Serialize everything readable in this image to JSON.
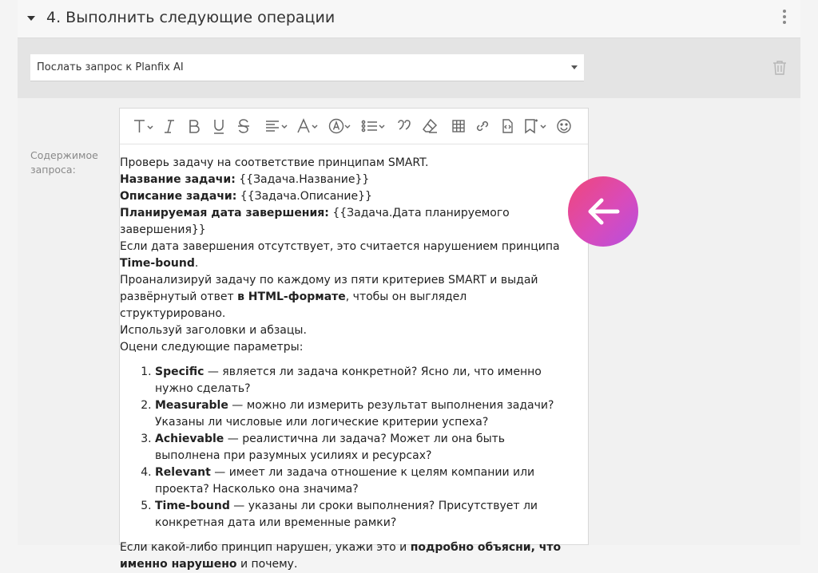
{
  "header": {
    "title": "4. Выполнить следующие операции"
  },
  "action": {
    "selected": "Послать запрос к Planfix AI"
  },
  "field": {
    "label_line1": "Содержимое",
    "label_line2": "запроса:"
  },
  "toolbar": {
    "icons": [
      "text-style-icon",
      "italic-icon",
      "bold-icon",
      "underline-icon",
      "strikethrough-icon",
      "align-icon",
      "font-color-icon",
      "highlight-icon",
      "list-icon",
      "quote-icon",
      "clear-format-icon",
      "table-icon",
      "link-icon",
      "code-icon",
      "bookmark-icon",
      "emoji-icon"
    ]
  },
  "content": {
    "line1": "Проверь задачу на соответствие принципам SMART.",
    "name_label": "Название задачи:",
    "name_value": " {{Задача.Название}}",
    "desc_label": "Описание задачи:",
    "desc_value": " {{Задача.Описание}}",
    "date_label": "Планируемая дата завершения:",
    "date_value": " {{Задача.Дата планируемого завершения}}",
    "missing_text": "Если дата завершения отсутствует, это считается нарушением принципа ",
    "missing_bold": "Time-bound",
    "missing_end": ".",
    "analyze_text": "Проанализируй задачу по каждому из пяти критериев SMART и выдай развёрнутый ответ ",
    "analyze_bold": "в HTML-формате",
    "analyze_end": ", чтобы он выглядел структурировано.",
    "use_text": "Используй заголовки и абзацы.",
    "eval_text": "Оцени следующие параметры:",
    "criteria": [
      {
        "name": "Specific",
        "text": " — является ли задача конкретной? Ясно ли, что именно нужно сделать?"
      },
      {
        "name": "Measurable",
        "text": " — можно ли измерить результат выполнения задачи? Указаны ли числовые или логические критерии успеха?"
      },
      {
        "name": "Achievable",
        "text": " — реалистична ли задача? Может ли она быть выполнена при разумных усилиях и ресурсах?"
      },
      {
        "name": "Relevant",
        "text": " — имеет ли задача отношение к целям компании или проекта? Насколько она значима?"
      },
      {
        "name": "Time-bound",
        "text": " — указаны ли сроки выполнения? Присутствует ли конкретная дата или временные рамки?"
      }
    ],
    "final_text": "Если какой-либо принцип нарушен, укажи это и ",
    "final_bold": "подробно объясни, что именно нарушено",
    "final_end": " и почему."
  },
  "colors": {
    "fab_start": "#f0467a",
    "fab_end": "#b64fe0"
  }
}
